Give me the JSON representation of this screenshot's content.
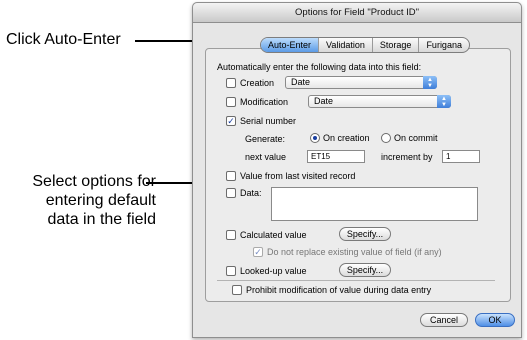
{
  "annotations": {
    "top": "Click Auto-Enter",
    "middle": [
      "Select options for",
      "entering default",
      "data in the field"
    ]
  },
  "dialog": {
    "title": "Options for Field \"Product ID\"",
    "tabs": [
      "Auto-Enter",
      "Validation",
      "Storage",
      "Furigana"
    ],
    "active_tab": "Auto-Enter",
    "heading": "Automatically enter the following data into this field:",
    "creation": {
      "label": "Creation",
      "checked": false,
      "select_value": "Date"
    },
    "modification": {
      "label": "Modification",
      "checked": false,
      "select_value": "Date"
    },
    "serial": {
      "label": "Serial number",
      "checked": true,
      "generate_label": "Generate:",
      "on_creation": "On creation",
      "on_commit": "On commit",
      "selected": "On creation",
      "next_value_label": "next value",
      "next_value": "ET15",
      "increment_label": "increment by",
      "increment": "1"
    },
    "last_visited": {
      "label": "Value from last visited record",
      "checked": false
    },
    "data": {
      "label": "Data:",
      "checked": false,
      "value": ""
    },
    "calculated": {
      "label": "Calculated value",
      "checked": false,
      "button": "Specify..."
    },
    "do_not_replace": {
      "label": "Do not replace existing value of field (if any)",
      "checked": true
    },
    "looked_up": {
      "label": "Looked-up value",
      "checked": false,
      "button": "Specify..."
    },
    "prohibit": {
      "label": "Prohibit modification of value during data entry",
      "checked": false
    },
    "cancel": "Cancel",
    "ok": "OK"
  },
  "icons": {
    "check": "checkmark-icon",
    "select": "updown-arrows-icon"
  },
  "colors": {
    "accent": "#5b9be6",
    "check": "#1a3fa0"
  }
}
